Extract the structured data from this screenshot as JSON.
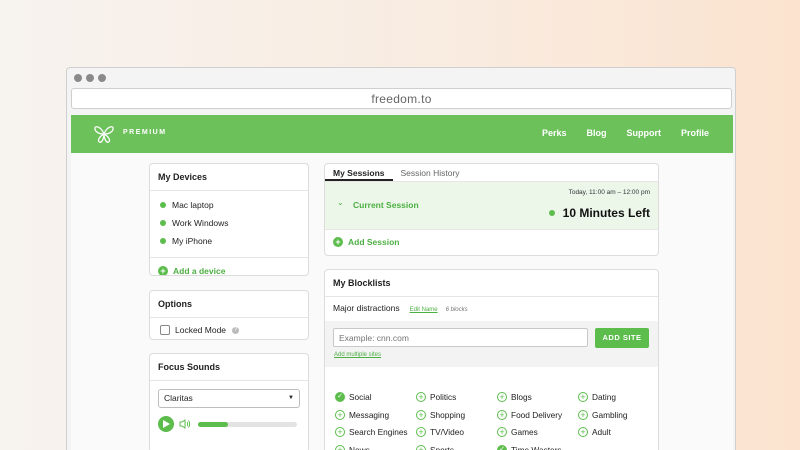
{
  "browser": {
    "url": "freedom.to"
  },
  "nav": {
    "brand": "PREMIUM",
    "links": [
      "Perks",
      "Blog",
      "Support",
      "Profile"
    ]
  },
  "devices": {
    "title": "My Devices",
    "items": [
      "Mac laptop",
      "Work Windows",
      "My iPhone"
    ],
    "add_label": "Add a device"
  },
  "options": {
    "title": "Options",
    "locked_mode_label": "Locked Mode"
  },
  "focus_sounds": {
    "title": "Focus Sounds",
    "selected": "Claritas",
    "progress": 0.3
  },
  "sessions": {
    "tabs": [
      "My Sessions",
      "Session History"
    ],
    "active_tab": "My Sessions",
    "current": {
      "label": "Current Session",
      "time_range": "Today, 11:00 am – 12:00 pm",
      "remaining": "10 Minutes Left"
    },
    "add_label": "Add Session"
  },
  "blocklists": {
    "title": "My Blocklists",
    "list_name": "Major distractions",
    "edit_label": "Edit Name",
    "count": "6 blocks",
    "site_placeholder": "Example: cnn.com",
    "add_site_label": "ADD SITE",
    "add_multiple_label": "Add multiple sites",
    "categories": [
      {
        "label": "Social",
        "checked": true
      },
      {
        "label": "Politics",
        "checked": false
      },
      {
        "label": "Blogs",
        "checked": false
      },
      {
        "label": "Dating",
        "checked": false
      },
      {
        "label": "Messaging",
        "checked": false
      },
      {
        "label": "Shopping",
        "checked": false
      },
      {
        "label": "Food Delivery",
        "checked": false
      },
      {
        "label": "Gambling",
        "checked": false
      },
      {
        "label": "Search Engines",
        "checked": false
      },
      {
        "label": "TV/Video",
        "checked": false
      },
      {
        "label": "Games",
        "checked": false
      },
      {
        "label": "Adult",
        "checked": false
      },
      {
        "label": "News",
        "checked": false
      },
      {
        "label": "Sports",
        "checked": false
      },
      {
        "label": "Time Wasters",
        "checked": true
      }
    ]
  },
  "colors": {
    "brand_green": "#6cc15b",
    "accent_green": "#5cbd4c"
  }
}
